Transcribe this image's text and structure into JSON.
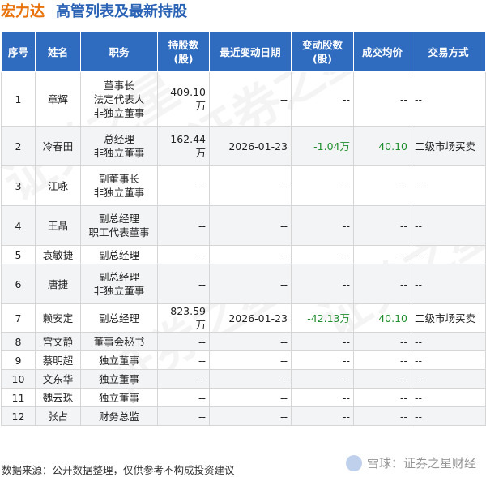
{
  "title": {
    "company": "宏力达",
    "subtitle": "高管列表及最新持股"
  },
  "table": {
    "headers": {
      "seq": "序号",
      "name": "姓名",
      "position": "职务",
      "holding_l1": "持股数",
      "holding_l2": "(股)",
      "date": "最近变动日期",
      "change_l1": "变动股数",
      "change_l2": "(股)",
      "price": "成交均价",
      "method": "交易方式"
    },
    "rows": [
      {
        "seq": "1",
        "name": "章辉",
        "pos": [
          "董事长",
          "法定代表人",
          "非独立董事"
        ],
        "holding": "409.10万",
        "date": "--",
        "change": "--",
        "price": "--",
        "method": "--"
      },
      {
        "seq": "2",
        "name": "冷春田",
        "pos": [
          "总经理",
          "非独立董事"
        ],
        "holding": "162.44万",
        "date": "2026-01-23",
        "change": "-1.04万",
        "price": "40.10",
        "method": "二级市场买卖"
      },
      {
        "seq": "3",
        "name": "江咏",
        "pos": [
          "副董事长",
          "非独立董事"
        ],
        "holding": "--",
        "date": "--",
        "change": "--",
        "price": "--",
        "method": "--"
      },
      {
        "seq": "4",
        "name": "王晶",
        "pos": [
          "副总经理",
          "职工代表董事"
        ],
        "holding": "--",
        "date": "--",
        "change": "--",
        "price": "--",
        "method": "--"
      },
      {
        "seq": "5",
        "name": "袁敏捷",
        "pos": [
          "副总经理"
        ],
        "holding": "--",
        "date": "--",
        "change": "--",
        "price": "--",
        "method": "--"
      },
      {
        "seq": "6",
        "name": "唐捷",
        "pos": [
          "副总经理",
          "非独立董事"
        ],
        "holding": "--",
        "date": "--",
        "change": "--",
        "price": "--",
        "method": "--"
      },
      {
        "seq": "7",
        "name": "赖安定",
        "pos": [
          "副总经理"
        ],
        "holding": "823.59万",
        "date": "2026-01-23",
        "change": "-42.13万",
        "price": "40.10",
        "method": "二级市场买卖"
      },
      {
        "seq": "8",
        "name": "宫文静",
        "pos": [
          "董事会秘书"
        ],
        "holding": "--",
        "date": "--",
        "change": "--",
        "price": "--",
        "method": "--"
      },
      {
        "seq": "9",
        "name": "蔡明超",
        "pos": [
          "独立董事"
        ],
        "holding": "--",
        "date": "--",
        "change": "--",
        "price": "--",
        "method": "--"
      },
      {
        "seq": "10",
        "name": "文东华",
        "pos": [
          "独立董事"
        ],
        "holding": "--",
        "date": "--",
        "change": "--",
        "price": "--",
        "method": "--"
      },
      {
        "seq": "11",
        "name": "魏云珠",
        "pos": [
          "独立董事"
        ],
        "holding": "--",
        "date": "--",
        "change": "--",
        "price": "--",
        "method": "--"
      },
      {
        "seq": "12",
        "name": "张占",
        "pos": [
          "财务总监"
        ],
        "holding": "--",
        "date": "--",
        "change": "--",
        "price": "--",
        "method": "--"
      }
    ]
  },
  "footer": "数据来源：公开数据整理，仅供参考不构成投资建议",
  "brand": "雪球：证券之星财经",
  "watermark": "证券之星",
  "colors": {
    "header_bg": "#2f6cc0",
    "company": "#e8730c",
    "subtitle": "#2a63b5",
    "change": "#1f8f2e"
  }
}
